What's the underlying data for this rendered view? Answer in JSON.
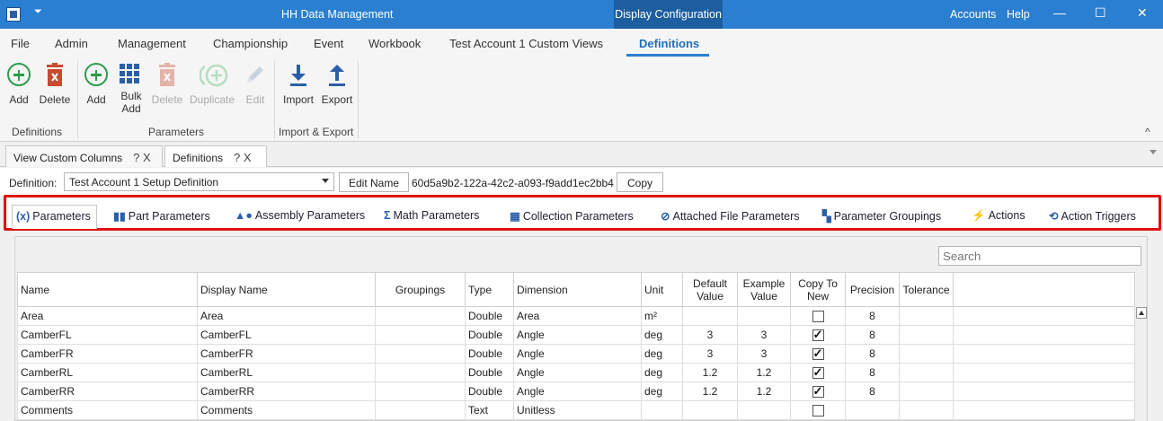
{
  "titlebar": {
    "title": "HH Data Management",
    "context_tab": "Display Configuration",
    "accounts": "Accounts",
    "help": "Help",
    "minimize": "—",
    "maximize": "☐",
    "close": "✕",
    "qat": "⏷"
  },
  "menu": {
    "items": [
      "File",
      "Admin",
      "Management",
      "Championship",
      "Event",
      "Workbook",
      "Test Account 1 Custom Views",
      "Definitions"
    ],
    "active": "Definitions"
  },
  "ribbon": {
    "definitions_group": {
      "label": "Definitions",
      "add": "Add",
      "delete": "Delete"
    },
    "parameters_group": {
      "label": "Parameters",
      "add": "Add",
      "bulk_add_1": "Bulk",
      "bulk_add_2": "Add",
      "delete": "Delete",
      "duplicate": "Duplicate",
      "edit": "Edit"
    },
    "import_export_group": {
      "label": "Import & Export",
      "import": "Import",
      "export": "Export"
    },
    "collapse": "^"
  },
  "doc_tabs": [
    {
      "label": "View Custom Columns",
      "qx": "? X"
    },
    {
      "label": "Definitions",
      "qx": "? X"
    }
  ],
  "definition": {
    "label": "Definition:",
    "value": "Test Account 1 Setup Definition",
    "edit_name": "Edit Name",
    "guid": "60d5a9b2-122a-42c2-a093-f9add1ec2bb4",
    "copy": "Copy"
  },
  "param_tabs": [
    {
      "icon": "(x)",
      "label": "Parameters"
    },
    {
      "icon": "▮▮",
      "label": "Part Parameters"
    },
    {
      "icon": "▲●",
      "label": "Assembly Parameters"
    },
    {
      "icon": "Σ",
      "label": "Math Parameters"
    },
    {
      "icon": "▦",
      "label": "Collection Parameters"
    },
    {
      "icon": "⊘",
      "label": "Attached File Parameters"
    },
    {
      "icon": "▚",
      "label": "Parameter Groupings"
    },
    {
      "icon": "⚡",
      "label": "Actions"
    },
    {
      "icon": "⟲",
      "label": "Action Triggers"
    }
  ],
  "search_placeholder": "Search",
  "grid": {
    "headers": {
      "name": "Name",
      "display_name": "Display Name",
      "groupings": "Groupings",
      "type": "Type",
      "dimension": "Dimension",
      "unit": "Unit",
      "default_value_1": "Default",
      "default_value_2": "Value",
      "example_value_1": "Example",
      "example_value_2": "Value",
      "copy_to_new_1": "Copy To",
      "copy_to_new_2": "New",
      "precision": "Precision",
      "tolerance": "Tolerance"
    },
    "rows": [
      {
        "name": "Area",
        "display_name": "Area",
        "groupings": "",
        "type": "Double",
        "dimension": "Area",
        "unit": "m²",
        "default_value": "",
        "example_value": "",
        "copy_to_new": false,
        "precision": "8",
        "tolerance": ""
      },
      {
        "name": "CamberFL",
        "display_name": "CamberFL",
        "groupings": "",
        "type": "Double",
        "dimension": "Angle",
        "unit": "deg",
        "default_value": "3",
        "example_value": "3",
        "copy_to_new": true,
        "precision": "8",
        "tolerance": ""
      },
      {
        "name": "CamberFR",
        "display_name": "CamberFR",
        "groupings": "",
        "type": "Double",
        "dimension": "Angle",
        "unit": "deg",
        "default_value": "3",
        "example_value": "3",
        "copy_to_new": true,
        "precision": "8",
        "tolerance": ""
      },
      {
        "name": "CamberRL",
        "display_name": "CamberRL",
        "groupings": "",
        "type": "Double",
        "dimension": "Angle",
        "unit": "deg",
        "default_value": "1.2",
        "example_value": "1.2",
        "copy_to_new": true,
        "precision": "8",
        "tolerance": ""
      },
      {
        "name": "CamberRR",
        "display_name": "CamberRR",
        "groupings": "",
        "type": "Double",
        "dimension": "Angle",
        "unit": "deg",
        "default_value": "1.2",
        "example_value": "1.2",
        "copy_to_new": true,
        "precision": "8",
        "tolerance": ""
      },
      {
        "name": "Comments",
        "display_name": "Comments",
        "groupings": "",
        "type": "Text",
        "dimension": "Unitless",
        "unit": "",
        "default_value": "",
        "example_value": "",
        "copy_to_new": false,
        "precision": "",
        "tolerance": ""
      }
    ]
  },
  "colors": {
    "titlebar": "#2b7fd1",
    "context_tab": "#1c5e9f",
    "accent": "#1f6fbd",
    "highlight_border": "#e01010",
    "add_green": "#2f9b4d",
    "delete_red": "#c84a2f"
  }
}
